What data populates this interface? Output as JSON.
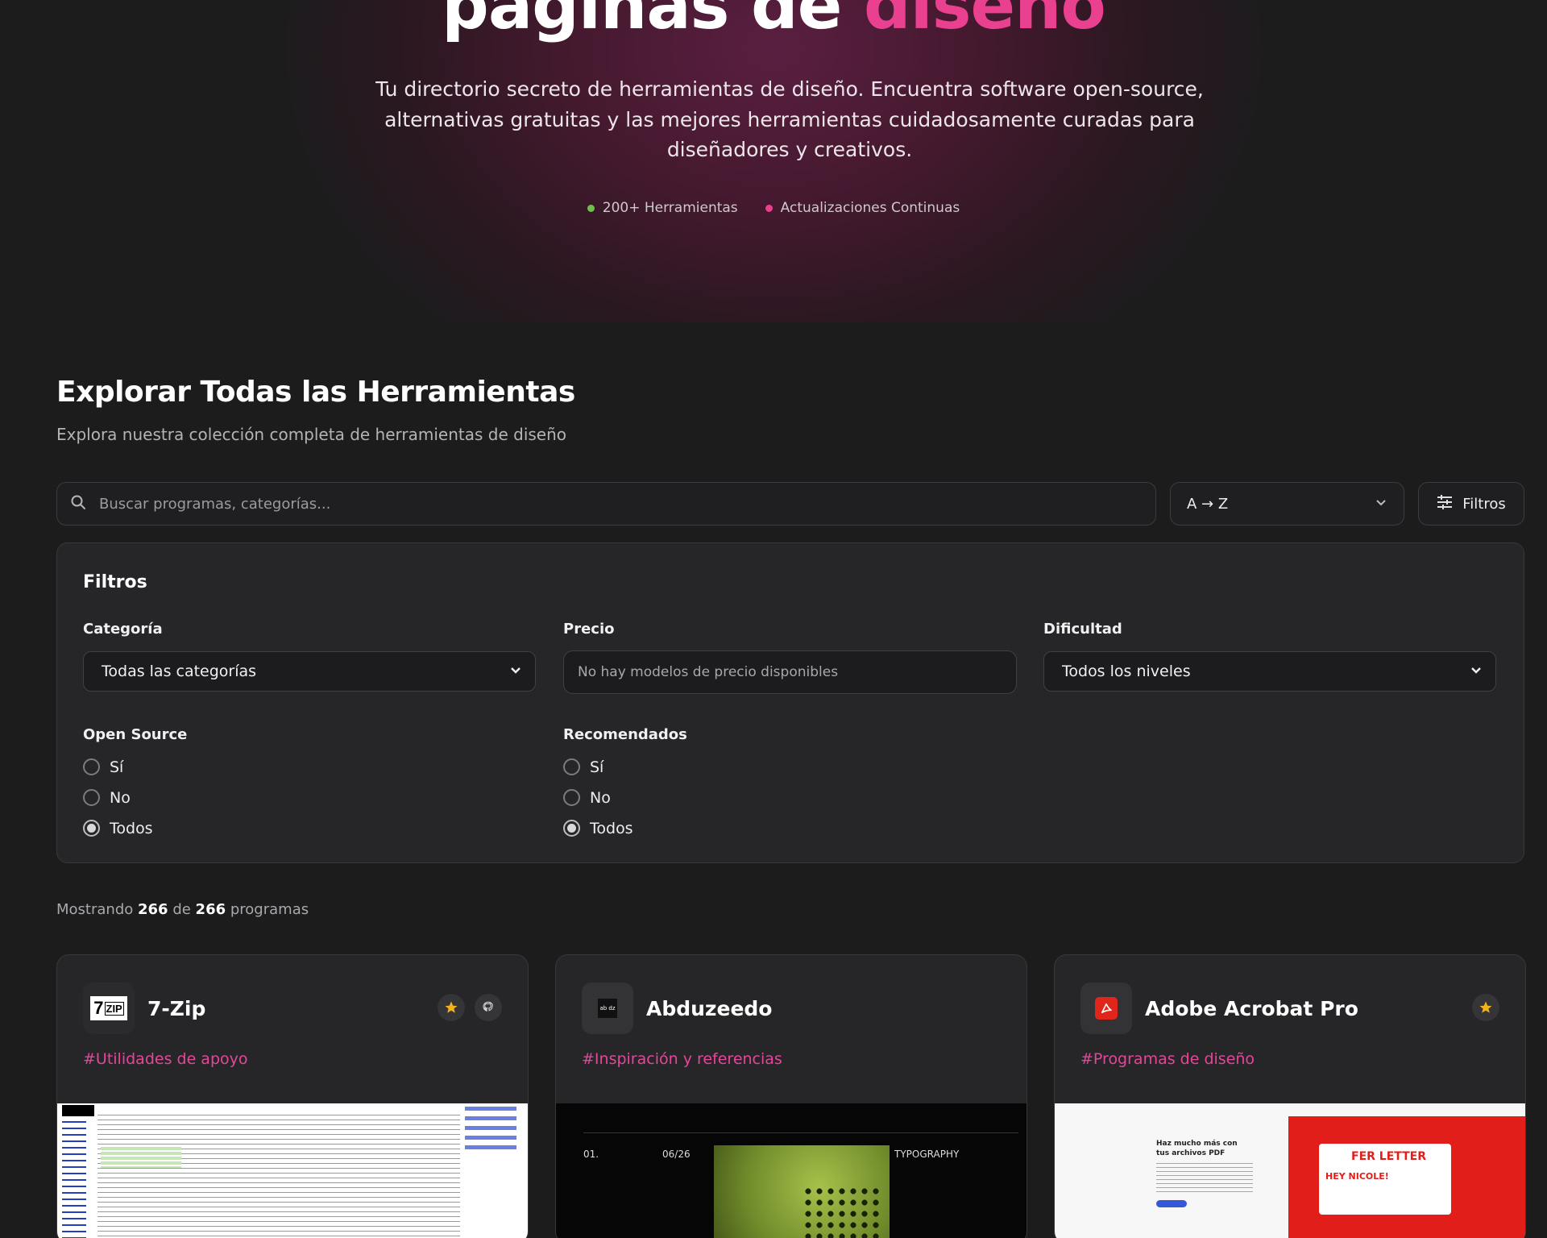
{
  "hero": {
    "title_part1": "páginas de",
    "title_part2": "diseño",
    "description": "Tu directorio secreto de herramientas de diseño. Encuentra software open-source, alternativas gratuitas y las mejores herramientas cuidadosamente curadas para diseñadores y creativos.",
    "stats": [
      {
        "label": "200+ Herramientas",
        "color": "#6fbf4a"
      },
      {
        "label": "Actualizaciones Continuas",
        "color": "#e9408f"
      }
    ]
  },
  "explore": {
    "title": "Explorar Todas las Herramientas",
    "subtitle": "Explora nuestra colección completa de herramientas de diseño"
  },
  "search": {
    "placeholder": "Buscar programas, categorías...",
    "value": ""
  },
  "sort": {
    "value": "A → Z"
  },
  "filters_button": {
    "label": "Filtros"
  },
  "filters": {
    "title": "Filtros",
    "category": {
      "label": "Categoría",
      "value": "Todas las categorías"
    },
    "price": {
      "label": "Precio",
      "value": "No hay modelos de precio disponibles"
    },
    "difficulty": {
      "label": "Dificultad",
      "value": "Todos los niveles"
    },
    "open_source": {
      "label": "Open Source",
      "options": [
        "Sí",
        "No",
        "Todos"
      ],
      "selected": "Todos"
    },
    "recommended": {
      "label": "Recomendados",
      "options": [
        "Sí",
        "No",
        "Todos"
      ],
      "selected": "Todos"
    }
  },
  "results": {
    "prefix": "Mostrando",
    "shown": "266",
    "middle": "de",
    "total": "266",
    "suffix": "programas"
  },
  "cards": [
    {
      "name": "7-Zip",
      "tag": "#Utilidades de apoyo",
      "logo_text": "7zip",
      "featured": true,
      "github": true
    },
    {
      "name": "Abduzeedo",
      "tag": "#Inspiración y referencias",
      "logo_text": "ab dz",
      "featured": false,
      "github": false,
      "preview": {
        "items": [
          "01.",
          "06/26",
          "TYPOGRAPHY"
        ]
      }
    },
    {
      "name": "Adobe Acrobat Pro",
      "tag": "#Programas de diseño",
      "logo_text": "",
      "featured": true,
      "github": false,
      "preview": {
        "headline": "Haz mucho más con tus archivos PDF",
        "banner": "FER LETTER",
        "sub": "HEY NICOLE!"
      }
    }
  ],
  "colors": {
    "accent": "#e9408f",
    "star": "#f2b21c",
    "background": "#1c1c1d"
  }
}
